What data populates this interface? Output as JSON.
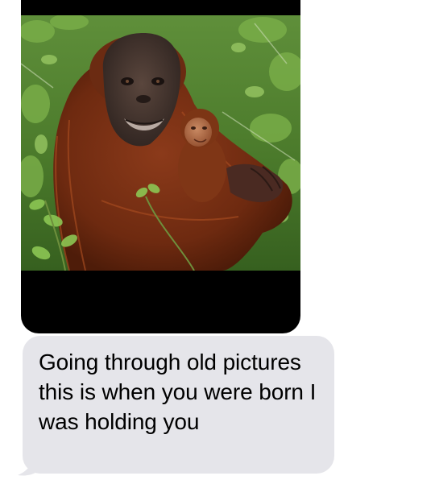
{
  "thread": {
    "photo_message": {
      "subject": "orangutan-mother-holding-baby"
    },
    "received_message": {
      "text": "Going through old pictures this is when you were born I was holding you"
    },
    "colors": {
      "received_bubble": "#e5e5ea",
      "message_text": "#000000",
      "photo_frame": "#000000",
      "background": "#ffffff"
    }
  }
}
